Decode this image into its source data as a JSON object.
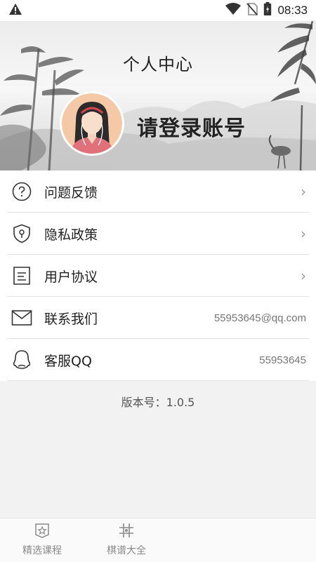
{
  "status_bar": {
    "time": "08:33",
    "icons": [
      "warning-icon",
      "wifi-icon",
      "no-sim-icon",
      "battery-icon"
    ]
  },
  "header": {
    "title": "个人中心",
    "login_prompt": "请登录账号"
  },
  "menu": {
    "items": [
      {
        "label": "问题反馈",
        "icon": "question-icon",
        "value": "",
        "has_chevron": true
      },
      {
        "label": "隐私政策",
        "icon": "shield-icon",
        "value": "",
        "has_chevron": true
      },
      {
        "label": "用户协议",
        "icon": "document-icon",
        "value": "",
        "has_chevron": true
      },
      {
        "label": "联系我们",
        "icon": "mail-icon",
        "value": "55953645@qq.com",
        "has_chevron": false
      },
      {
        "label": "客服QQ",
        "icon": "qq-icon",
        "value": "55953645",
        "has_chevron": false
      }
    ],
    "chevron": "›"
  },
  "version_text": "版本号：1.0.5",
  "bottom_nav": {
    "items": [
      {
        "label": "精选课程",
        "icon": "star-badge-icon"
      },
      {
        "label": "棋谱大全",
        "icon": "chess-grid-icon"
      }
    ]
  },
  "colors": {
    "text": "#222222",
    "secondary": "#777777",
    "divider": "#e3e3e3",
    "background": "#f2f2f2",
    "avatar_bg": "#f5c9a6"
  }
}
